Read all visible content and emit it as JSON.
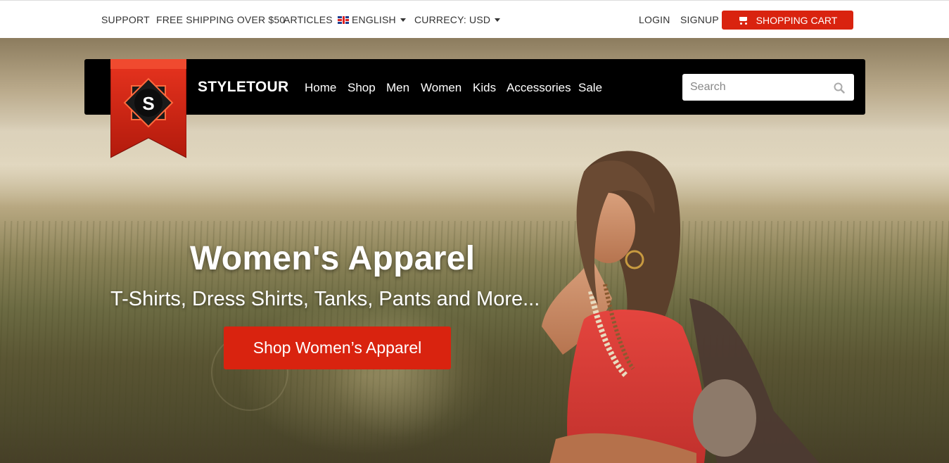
{
  "topbar": {
    "support": "SUPPORT",
    "shipping": "FREE SHIPPING OVER $50",
    "articles": "ARTICLES",
    "language": "ENGLISH",
    "currency": "CURRECY: USD",
    "login": "LOGIN",
    "signup": "SIGNUP",
    "cart": "SHOPPING CART"
  },
  "nav": {
    "logo_letter": "S",
    "brand": "STYLETOUR",
    "links": [
      "Home",
      "Shop",
      "Men",
      "Women",
      "Kids",
      "Accessories",
      "Sale"
    ],
    "search_placeholder": "Search"
  },
  "hero": {
    "title": "Women's Apparel",
    "subtitle": "T-Shirts, Dress Shirts, Tanks, Pants and More...",
    "button": "Shop Women’s Apparel"
  },
  "colors": {
    "accent": "#d9230f",
    "navbar": "#000000"
  },
  "icons": {
    "cart": "shopping-cart-icon",
    "search": "search-icon",
    "flag": "uk-flag-icon",
    "dropdown": "caret-down-icon"
  }
}
